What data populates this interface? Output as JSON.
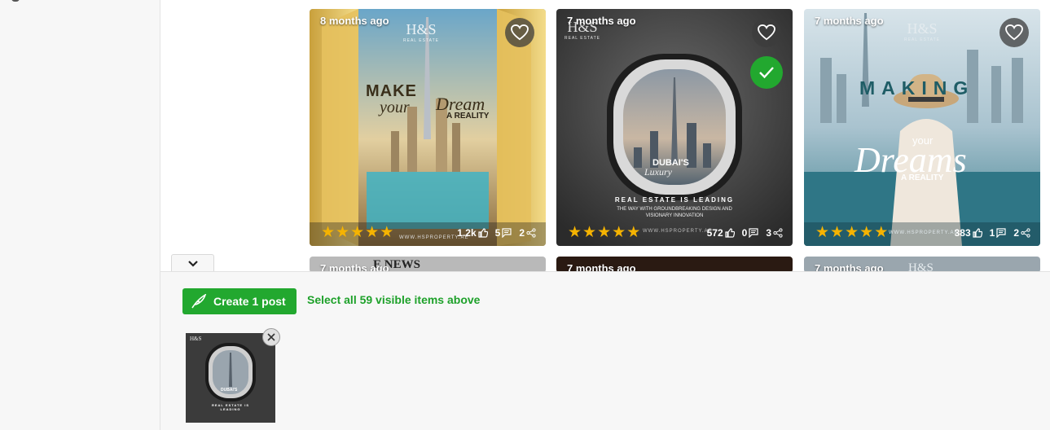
{
  "cards": [
    {
      "age": "8 months ago",
      "rating": 5,
      "likes": "1.2k",
      "comments": "5",
      "shares": "2",
      "selected": false,
      "image_text": {
        "brand": "H&S",
        "brand_sub": "REAL ESTATE",
        "headline": "MAKE",
        "script1": "your",
        "script2": "Dream",
        "tag": "A REALITY",
        "url": "WWW.HSPROPERTY.AE"
      }
    },
    {
      "age": "7 months ago",
      "rating": 5,
      "likes": "572",
      "comments": "0",
      "shares": "3",
      "selected": true,
      "image_text": {
        "brand": "H&S",
        "brand_sub": "REAL ESTATE",
        "headline": "DUBAI'S",
        "script1": "Luxury",
        "line1": "REAL ESTATE IS LEADING",
        "line2": "THE WAY WITH GROUNDBREAKING DESIGN AND",
        "line3": "VISIONARY INNOVATION",
        "url": "WWW.HSPROPERTY.AE"
      }
    },
    {
      "age": "7 months ago",
      "rating": 5,
      "likes": "383",
      "comments": "1",
      "shares": "2",
      "selected": false,
      "image_text": {
        "brand": "H&S",
        "brand_sub": "REAL ESTATE",
        "headline": "MAKING",
        "script1": "your",
        "script2": "Dreams",
        "tag": "A REALITY",
        "url": "WWW.HSPROPERTY.AE"
      }
    }
  ],
  "next_row": [
    {
      "age": "7 months ago",
      "image_text": "E NEWS"
    },
    {
      "age": "7 months ago"
    },
    {
      "age": "7 months ago",
      "image_text": "H&S"
    }
  ],
  "bottom": {
    "create_label": "Create 1 post",
    "select_all_label": "Select all 59 visible items above",
    "thumb": {
      "brand": "H&S",
      "headline": "DUBAI'S",
      "line1": "REAL ESTATE IS LEADING"
    }
  },
  "colors": {
    "accent": "#22a82f",
    "star": "#f5b301"
  }
}
